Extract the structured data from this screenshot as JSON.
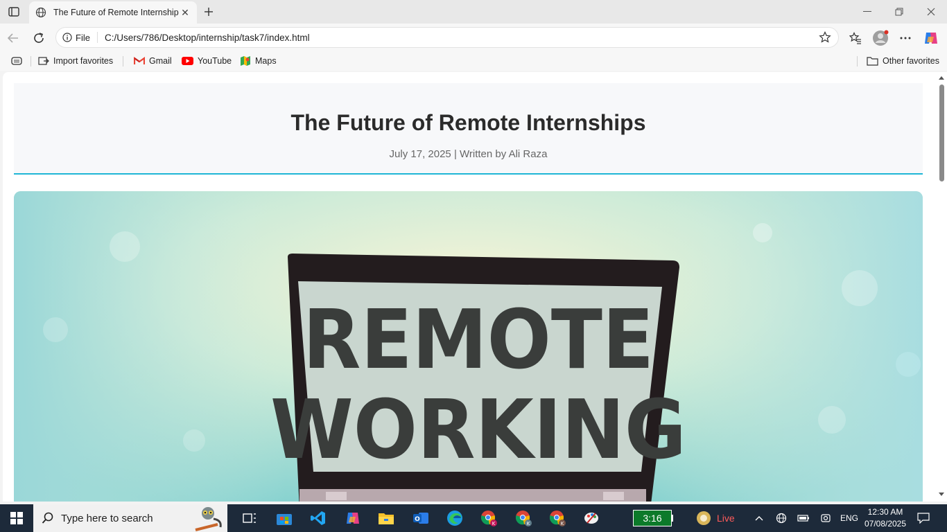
{
  "browser": {
    "tab_title": "The Future of Remote Internships",
    "address_scheme": "File",
    "url": "C:/Users/786/Desktop/internship/task7/index.html",
    "bookmarks": [
      "Import favorites",
      "Gmail",
      "YouTube",
      "Maps"
    ],
    "other_favorites": "Other favorites"
  },
  "page": {
    "title": "The Future of Remote Internships",
    "meta": "July 17, 2025 | Written by Ali Raza",
    "hero_text_line1": "REMOTE",
    "hero_text_line2": "WORKING"
  },
  "taskbar": {
    "search_placeholder": "Type here to search",
    "battery_time": "3:16",
    "weather_label": "Live",
    "language": "ENG",
    "time": "12:30 AM",
    "date": "07/08/2025"
  },
  "colors": {
    "accent": "#1fb6d6",
    "taskbar_bg": "#1d2a3a",
    "title_text": "#2b2b2b"
  }
}
